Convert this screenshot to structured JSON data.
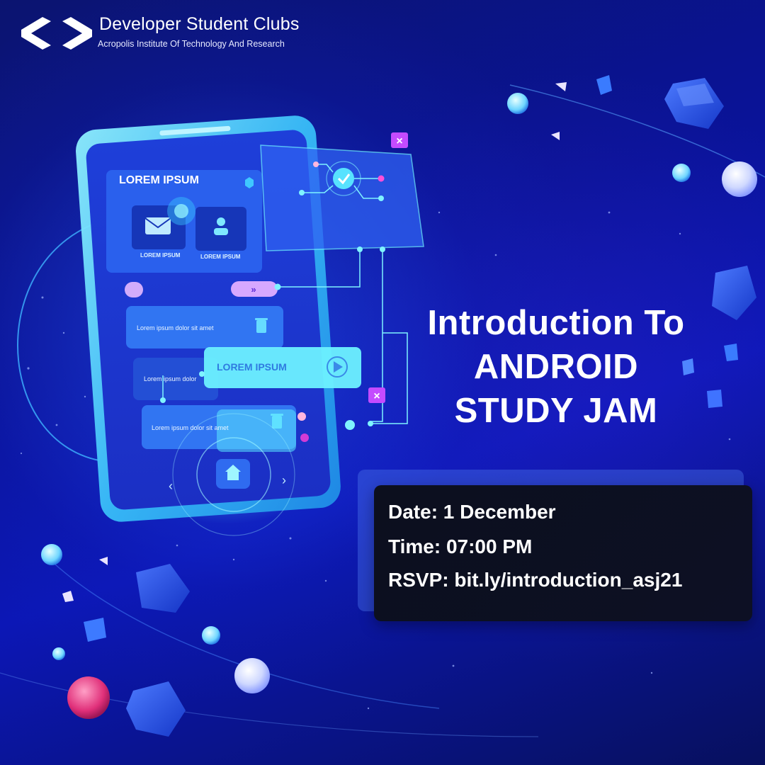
{
  "brand": {
    "title": "Developer Student Clubs",
    "subtitle": "Acropolis Institute Of Technology And Research",
    "logo_icon": "gdsc-brackets-logo"
  },
  "headline": {
    "line1": "Introduction To",
    "line2": "ANDROID",
    "line3": "STUDY JAM"
  },
  "event": {
    "date": "Date: 1 December",
    "time": "Time: 07:00 PM",
    "rsvp": "RSVP: bit.ly/introduction_asj21"
  },
  "phone_ui": {
    "header": "LOREM IPSUM",
    "tile1_label": "LOREM IPSUM",
    "tile2_label": "LOREM IPSUM",
    "row1_text": "Lorem ipsum dolor sit amet",
    "row2_text": "Lorem ipsum dolor",
    "row3_text": "Lorem ipsum dolor sit amet",
    "floating_button": "LOREM IPSUM"
  },
  "colors": {
    "background": "#0a1398",
    "accent_cyan": "#39e6ff",
    "accent_pink": "#ff4fd8",
    "card": "#0c0f1e",
    "text": "#ffffff"
  }
}
